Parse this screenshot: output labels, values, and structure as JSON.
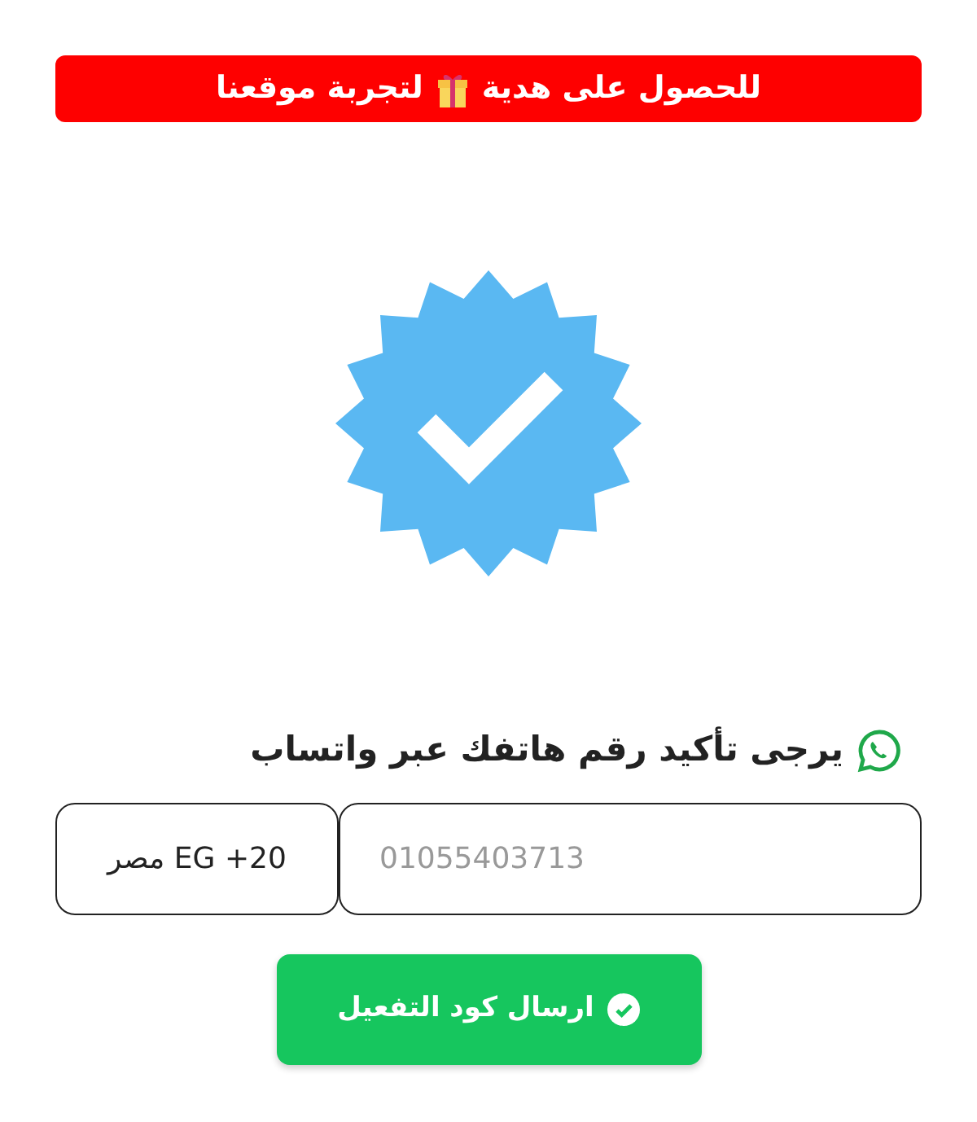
{
  "banner": {
    "text_before": "للحصول على هدية",
    "text_after": "لتجربة موقعنا"
  },
  "heading": "يرجى تأكيد رقم هاتفك عبر واتساب",
  "country_select": {
    "value": "مصر EG +20"
  },
  "phone_field": {
    "placeholder": "01055403713"
  },
  "submit_button": {
    "label": "ارسال كود التفعيل"
  }
}
